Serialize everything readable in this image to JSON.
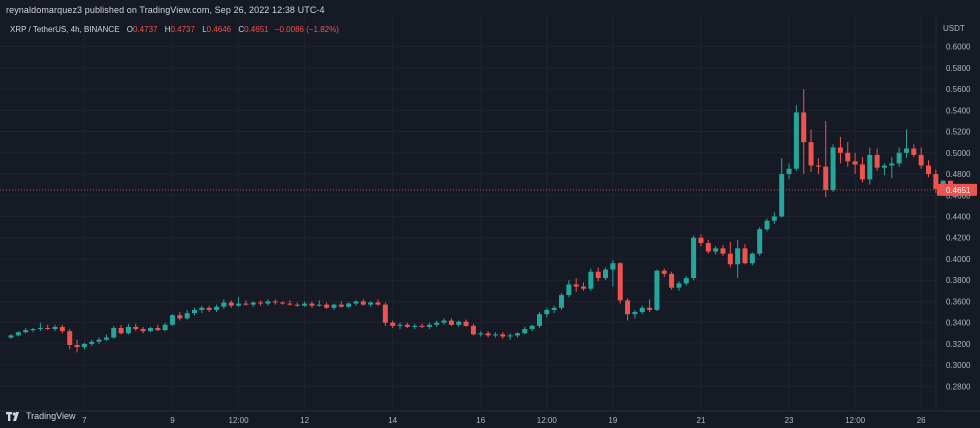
{
  "header": {
    "publish_text": "reynaldomarquez3 published on TradingView.com, Sep 26, 2022 12:38 UTC-4",
    "symbol": "XRP / TetherUS, 4h, BINANCE",
    "ohlc": [
      {
        "label": "O",
        "value": "0.4737"
      },
      {
        "label": "H",
        "value": "0.4737"
      },
      {
        "label": "L",
        "value": "0.4646"
      },
      {
        "label": "C",
        "value": "0.4651"
      }
    ],
    "change": "−0.0086 (−1.82%)"
  },
  "footer": {
    "logo_text": "TradingView"
  },
  "colors": {
    "background": "#161a25",
    "grid": "#1f2330",
    "up": "#26a69a",
    "down": "#ef5350",
    "text": "#b2b5be",
    "price_line": "#ef5350"
  },
  "chart_data": {
    "type": "candlestick",
    "currency": "USDT",
    "timeframe": "4h",
    "ylim": [
      0.27,
      0.61
    ],
    "y_ticks": [
      "0.2800",
      "0.3000",
      "0.3200",
      "0.3400",
      "0.3600",
      "0.3800",
      "0.4000",
      "0.4200",
      "0.4400",
      "0.4600",
      "0.4800",
      "0.5000",
      "0.5200",
      "0.5400",
      "0.5600",
      "0.5800",
      "0.6000"
    ],
    "x_ticks": [
      {
        "label": "7",
        "bar": 10
      },
      {
        "label": "9",
        "bar": 22
      },
      {
        "label": "12:00",
        "bar": 31
      },
      {
        "label": "12",
        "bar": 40
      },
      {
        "label": "14",
        "bar": 52
      },
      {
        "label": "16",
        "bar": 64
      },
      {
        "label": "12:00",
        "bar": 73
      },
      {
        "label": "19",
        "bar": 82
      },
      {
        "label": "21",
        "bar": 94
      },
      {
        "label": "23",
        "bar": 106
      },
      {
        "label": "12:00",
        "bar": 115
      },
      {
        "label": "26",
        "bar": 124
      }
    ],
    "last_price": "0.4651",
    "candles": [
      {
        "o": 0.326,
        "h": 0.329,
        "l": 0.325,
        "c": 0.328
      },
      {
        "o": 0.328,
        "h": 0.332,
        "l": 0.327,
        "c": 0.331
      },
      {
        "o": 0.331,
        "h": 0.335,
        "l": 0.33,
        "c": 0.333
      },
      {
        "o": 0.333,
        "h": 0.335,
        "l": 0.331,
        "c": 0.334
      },
      {
        "o": 0.334,
        "h": 0.34,
        "l": 0.332,
        "c": 0.335
      },
      {
        "o": 0.335,
        "h": 0.338,
        "l": 0.333,
        "c": 0.334
      },
      {
        "o": 0.334,
        "h": 0.338,
        "l": 0.332,
        "c": 0.336
      },
      {
        "o": 0.336,
        "h": 0.338,
        "l": 0.33,
        "c": 0.332
      },
      {
        "o": 0.332,
        "h": 0.334,
        "l": 0.315,
        "c": 0.319
      },
      {
        "o": 0.319,
        "h": 0.324,
        "l": 0.312,
        "c": 0.317
      },
      {
        "o": 0.317,
        "h": 0.321,
        "l": 0.315,
        "c": 0.32
      },
      {
        "o": 0.32,
        "h": 0.324,
        "l": 0.318,
        "c": 0.322
      },
      {
        "o": 0.322,
        "h": 0.326,
        "l": 0.32,
        "c": 0.324
      },
      {
        "o": 0.324,
        "h": 0.329,
        "l": 0.323,
        "c": 0.326
      },
      {
        "o": 0.326,
        "h": 0.337,
        "l": 0.325,
        "c": 0.335
      },
      {
        "o": 0.335,
        "h": 0.338,
        "l": 0.329,
        "c": 0.33
      },
      {
        "o": 0.33,
        "h": 0.339,
        "l": 0.329,
        "c": 0.336
      },
      {
        "o": 0.336,
        "h": 0.339,
        "l": 0.332,
        "c": 0.334
      },
      {
        "o": 0.334,
        "h": 0.336,
        "l": 0.33,
        "c": 0.332
      },
      {
        "o": 0.332,
        "h": 0.336,
        "l": 0.331,
        "c": 0.335
      },
      {
        "o": 0.335,
        "h": 0.338,
        "l": 0.332,
        "c": 0.333
      },
      {
        "o": 0.333,
        "h": 0.34,
        "l": 0.332,
        "c": 0.338
      },
      {
        "o": 0.338,
        "h": 0.348,
        "l": 0.337,
        "c": 0.347
      },
      {
        "o": 0.347,
        "h": 0.35,
        "l": 0.342,
        "c": 0.344
      },
      {
        "o": 0.344,
        "h": 0.352,
        "l": 0.343,
        "c": 0.349
      },
      {
        "o": 0.349,
        "h": 0.354,
        "l": 0.347,
        "c": 0.352
      },
      {
        "o": 0.352,
        "h": 0.356,
        "l": 0.349,
        "c": 0.354
      },
      {
        "o": 0.354,
        "h": 0.356,
        "l": 0.35,
        "c": 0.352
      },
      {
        "o": 0.352,
        "h": 0.357,
        "l": 0.35,
        "c": 0.355
      },
      {
        "o": 0.355,
        "h": 0.362,
        "l": 0.353,
        "c": 0.359
      },
      {
        "o": 0.359,
        "h": 0.361,
        "l": 0.354,
        "c": 0.356
      },
      {
        "o": 0.356,
        "h": 0.364,
        "l": 0.355,
        "c": 0.358
      },
      {
        "o": 0.358,
        "h": 0.361,
        "l": 0.356,
        "c": 0.357
      },
      {
        "o": 0.357,
        "h": 0.36,
        "l": 0.355,
        "c": 0.359
      },
      {
        "o": 0.359,
        "h": 0.361,
        "l": 0.356,
        "c": 0.358
      },
      {
        "o": 0.358,
        "h": 0.362,
        "l": 0.356,
        "c": 0.36
      },
      {
        "o": 0.36,
        "h": 0.362,
        "l": 0.357,
        "c": 0.359
      },
      {
        "o": 0.359,
        "h": 0.36,
        "l": 0.357,
        "c": 0.358
      },
      {
        "o": 0.358,
        "h": 0.361,
        "l": 0.356,
        "c": 0.357
      },
      {
        "o": 0.357,
        "h": 0.359,
        "l": 0.355,
        "c": 0.356
      },
      {
        "o": 0.356,
        "h": 0.36,
        "l": 0.355,
        "c": 0.358
      },
      {
        "o": 0.358,
        "h": 0.36,
        "l": 0.354,
        "c": 0.356
      },
      {
        "o": 0.356,
        "h": 0.361,
        "l": 0.355,
        "c": 0.357
      },
      {
        "o": 0.357,
        "h": 0.359,
        "l": 0.353,
        "c": 0.354
      },
      {
        "o": 0.354,
        "h": 0.358,
        "l": 0.352,
        "c": 0.357
      },
      {
        "o": 0.357,
        "h": 0.36,
        "l": 0.354,
        "c": 0.355
      },
      {
        "o": 0.355,
        "h": 0.359,
        "l": 0.354,
        "c": 0.358
      },
      {
        "o": 0.358,
        "h": 0.361,
        "l": 0.356,
        "c": 0.36
      },
      {
        "o": 0.36,
        "h": 0.362,
        "l": 0.356,
        "c": 0.357
      },
      {
        "o": 0.357,
        "h": 0.36,
        "l": 0.355,
        "c": 0.359
      },
      {
        "o": 0.359,
        "h": 0.362,
        "l": 0.356,
        "c": 0.357
      },
      {
        "o": 0.357,
        "h": 0.359,
        "l": 0.337,
        "c": 0.34
      },
      {
        "o": 0.34,
        "h": 0.342,
        "l": 0.335,
        "c": 0.337
      },
      {
        "o": 0.337,
        "h": 0.34,
        "l": 0.334,
        "c": 0.338
      },
      {
        "o": 0.338,
        "h": 0.34,
        "l": 0.335,
        "c": 0.336
      },
      {
        "o": 0.336,
        "h": 0.339,
        "l": 0.334,
        "c": 0.337
      },
      {
        "o": 0.337,
        "h": 0.339,
        "l": 0.335,
        "c": 0.336
      },
      {
        "o": 0.336,
        "h": 0.34,
        "l": 0.334,
        "c": 0.338
      },
      {
        "o": 0.338,
        "h": 0.342,
        "l": 0.336,
        "c": 0.34
      },
      {
        "o": 0.34,
        "h": 0.344,
        "l": 0.338,
        "c": 0.342
      },
      {
        "o": 0.342,
        "h": 0.344,
        "l": 0.337,
        "c": 0.338
      },
      {
        "o": 0.338,
        "h": 0.342,
        "l": 0.336,
        "c": 0.341
      },
      {
        "o": 0.341,
        "h": 0.343,
        "l": 0.336,
        "c": 0.337
      },
      {
        "o": 0.337,
        "h": 0.339,
        "l": 0.328,
        "c": 0.329
      },
      {
        "o": 0.329,
        "h": 0.332,
        "l": 0.327,
        "c": 0.33
      },
      {
        "o": 0.33,
        "h": 0.332,
        "l": 0.326,
        "c": 0.328
      },
      {
        "o": 0.328,
        "h": 0.331,
        "l": 0.326,
        "c": 0.329
      },
      {
        "o": 0.329,
        "h": 0.331,
        "l": 0.325,
        "c": 0.327
      },
      {
        "o": 0.327,
        "h": 0.33,
        "l": 0.324,
        "c": 0.328
      },
      {
        "o": 0.328,
        "h": 0.331,
        "l": 0.326,
        "c": 0.33
      },
      {
        "o": 0.33,
        "h": 0.336,
        "l": 0.329,
        "c": 0.334
      },
      {
        "o": 0.334,
        "h": 0.338,
        "l": 0.332,
        "c": 0.337
      },
      {
        "o": 0.337,
        "h": 0.35,
        "l": 0.335,
        "c": 0.348
      },
      {
        "o": 0.348,
        "h": 0.354,
        "l": 0.345,
        "c": 0.352
      },
      {
        "o": 0.352,
        "h": 0.356,
        "l": 0.349,
        "c": 0.354
      },
      {
        "o": 0.354,
        "h": 0.368,
        "l": 0.352,
        "c": 0.366
      },
      {
        "o": 0.366,
        "h": 0.38,
        "l": 0.364,
        "c": 0.376
      },
      {
        "o": 0.376,
        "h": 0.382,
        "l": 0.369,
        "c": 0.374
      },
      {
        "o": 0.374,
        "h": 0.378,
        "l": 0.37,
        "c": 0.372
      },
      {
        "o": 0.372,
        "h": 0.391,
        "l": 0.37,
        "c": 0.388
      },
      {
        "o": 0.388,
        "h": 0.392,
        "l": 0.379,
        "c": 0.382
      },
      {
        "o": 0.382,
        "h": 0.392,
        "l": 0.38,
        "c": 0.39
      },
      {
        "o": 0.39,
        "h": 0.399,
        "l": 0.374,
        "c": 0.396
      },
      {
        "o": 0.396,
        "h": 0.397,
        "l": 0.358,
        "c": 0.361
      },
      {
        "o": 0.361,
        "h": 0.363,
        "l": 0.342,
        "c": 0.348
      },
      {
        "o": 0.348,
        "h": 0.352,
        "l": 0.344,
        "c": 0.35
      },
      {
        "o": 0.35,
        "h": 0.356,
        "l": 0.348,
        "c": 0.354
      },
      {
        "o": 0.354,
        "h": 0.362,
        "l": 0.35,
        "c": 0.352
      },
      {
        "o": 0.352,
        "h": 0.39,
        "l": 0.351,
        "c": 0.389
      },
      {
        "o": 0.389,
        "h": 0.391,
        "l": 0.383,
        "c": 0.386
      },
      {
        "o": 0.386,
        "h": 0.388,
        "l": 0.371,
        "c": 0.373
      },
      {
        "o": 0.373,
        "h": 0.379,
        "l": 0.37,
        "c": 0.377
      },
      {
        "o": 0.377,
        "h": 0.384,
        "l": 0.375,
        "c": 0.382
      },
      {
        "o": 0.382,
        "h": 0.422,
        "l": 0.38,
        "c": 0.42
      },
      {
        "o": 0.42,
        "h": 0.423,
        "l": 0.412,
        "c": 0.415
      },
      {
        "o": 0.415,
        "h": 0.418,
        "l": 0.405,
        "c": 0.407
      },
      {
        "o": 0.407,
        "h": 0.412,
        "l": 0.404,
        "c": 0.41
      },
      {
        "o": 0.41,
        "h": 0.413,
        "l": 0.403,
        "c": 0.405
      },
      {
        "o": 0.405,
        "h": 0.416,
        "l": 0.392,
        "c": 0.395
      },
      {
        "o": 0.395,
        "h": 0.418,
        "l": 0.382,
        "c": 0.41
      },
      {
        "o": 0.41,
        "h": 0.414,
        "l": 0.395,
        "c": 0.396
      },
      {
        "o": 0.396,
        "h": 0.406,
        "l": 0.394,
        "c": 0.405
      },
      {
        "o": 0.405,
        "h": 0.43,
        "l": 0.403,
        "c": 0.428
      },
      {
        "o": 0.428,
        "h": 0.438,
        "l": 0.426,
        "c": 0.436
      },
      {
        "o": 0.436,
        "h": 0.444,
        "l": 0.433,
        "c": 0.44
      },
      {
        "o": 0.44,
        "h": 0.495,
        "l": 0.439,
        "c": 0.48
      },
      {
        "o": 0.48,
        "h": 0.49,
        "l": 0.475,
        "c": 0.485
      },
      {
        "o": 0.485,
        "h": 0.545,
        "l": 0.483,
        "c": 0.538
      },
      {
        "o": 0.538,
        "h": 0.56,
        "l": 0.48,
        "c": 0.51
      },
      {
        "o": 0.51,
        "h": 0.522,
        "l": 0.482,
        "c": 0.488
      },
      {
        "o": 0.488,
        "h": 0.495,
        "l": 0.48,
        "c": 0.487
      },
      {
        "o": 0.487,
        "h": 0.53,
        "l": 0.458,
        "c": 0.465
      },
      {
        "o": 0.465,
        "h": 0.508,
        "l": 0.463,
        "c": 0.505
      },
      {
        "o": 0.505,
        "h": 0.515,
        "l": 0.49,
        "c": 0.5
      },
      {
        "o": 0.5,
        "h": 0.51,
        "l": 0.487,
        "c": 0.492
      },
      {
        "o": 0.492,
        "h": 0.5,
        "l": 0.48,
        "c": 0.489
      },
      {
        "o": 0.489,
        "h": 0.496,
        "l": 0.472,
        "c": 0.475
      },
      {
        "o": 0.475,
        "h": 0.505,
        "l": 0.47,
        "c": 0.498
      },
      {
        "o": 0.498,
        "h": 0.504,
        "l": 0.483,
        "c": 0.486
      },
      {
        "o": 0.486,
        "h": 0.49,
        "l": 0.479,
        "c": 0.488
      },
      {
        "o": 0.488,
        "h": 0.496,
        "l": 0.476,
        "c": 0.49
      },
      {
        "o": 0.49,
        "h": 0.505,
        "l": 0.487,
        "c": 0.5
      },
      {
        "o": 0.5,
        "h": 0.522,
        "l": 0.495,
        "c": 0.504
      },
      {
        "o": 0.504,
        "h": 0.508,
        "l": 0.496,
        "c": 0.498
      },
      {
        "o": 0.498,
        "h": 0.505,
        "l": 0.485,
        "c": 0.488
      },
      {
        "o": 0.488,
        "h": 0.493,
        "l": 0.477,
        "c": 0.48
      },
      {
        "o": 0.48,
        "h": 0.484,
        "l": 0.462,
        "c": 0.466
      },
      {
        "o": 0.466,
        "h": 0.474,
        "l": 0.46,
        "c": 0.4737
      },
      {
        "o": 0.4737,
        "h": 0.4737,
        "l": 0.4646,
        "c": 0.4651
      }
    ]
  }
}
